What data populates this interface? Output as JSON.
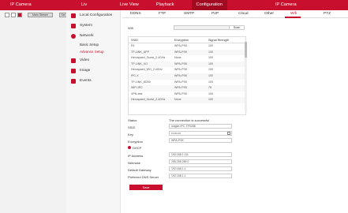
{
  "app": {
    "title": "IP Camera",
    "title2": "Liv",
    "title3": "IP Camera"
  },
  "topnav": [
    "Live View",
    "Playback",
    "Configuration"
  ],
  "left_toolbar": {
    "btn1": "Main Stream",
    "btn2": "Set"
  },
  "menu": {
    "items": [
      {
        "label": "Local Configuration"
      },
      {
        "label": "System"
      },
      {
        "label": "Network"
      },
      {
        "label": "Video"
      },
      {
        "label": "Image"
      },
      {
        "label": "Events"
      }
    ],
    "subitems": [
      {
        "label": "Basic Setup"
      },
      {
        "label": "Advance Setup"
      }
    ]
  },
  "tabs": [
    "DDNS",
    "FTP",
    "SMTP",
    "P2P",
    "Cloud",
    "Other",
    "Wifi",
    "PTZ"
  ],
  "wifi": {
    "label": "Wifi",
    "scan": "Scan",
    "table": {
      "headers": [
        "SSID",
        "Encryption",
        "Signal Strength"
      ],
      "rows": [
        [
          "P4",
          "WPA-PSK",
          "100"
        ],
        [
          "TP-LINK_APP",
          "WPA-PSK",
          "100"
        ],
        [
          "Hercapaed_Guest_2.4GHz",
          "None",
          "100"
        ],
        [
          "TP-LINK_XO",
          "WPA-PSK",
          "100"
        ],
        [
          "Hercapaed_WO_2.4GHz",
          "WPA-PSK",
          "100"
        ],
        [
          "IPC-X",
          "WPA-PSK",
          "100"
        ],
        [
          "TP-LINK_8CB0",
          "WPA-PSK",
          "100"
        ],
        [
          "WIFI-IPC",
          "WPA-PSK",
          "78"
        ],
        [
          "VPN-test",
          "WPA-PSK",
          "100"
        ],
        [
          "Hercapaed_Guest_2.4GHz",
          "None",
          "100"
        ]
      ]
    },
    "form": {
      "status_label": "Status",
      "status_value": "The connection is successful",
      "ssid_label": "SSID",
      "ssid_value": "longse-IPC-TP5288",
      "key_label": "Key",
      "key_value": "••••••••••",
      "encryption_label": "Encryption",
      "encryption_value": "WPA-PSK",
      "dhcp_label": "DHCP",
      "ip_label": "IP Address",
      "ip_value": "192.168.1.111",
      "netmask_label": "Netmask",
      "netmask_value": "255.255.255.0",
      "gateway_label": "Default Gateway",
      "gateway_value": "192.168.1.1",
      "dns_label": "Preferred DNS Server",
      "dns_value": "192.168.1.1",
      "save": "Save"
    }
  },
  "colors": {
    "accent": "#c8102e"
  }
}
